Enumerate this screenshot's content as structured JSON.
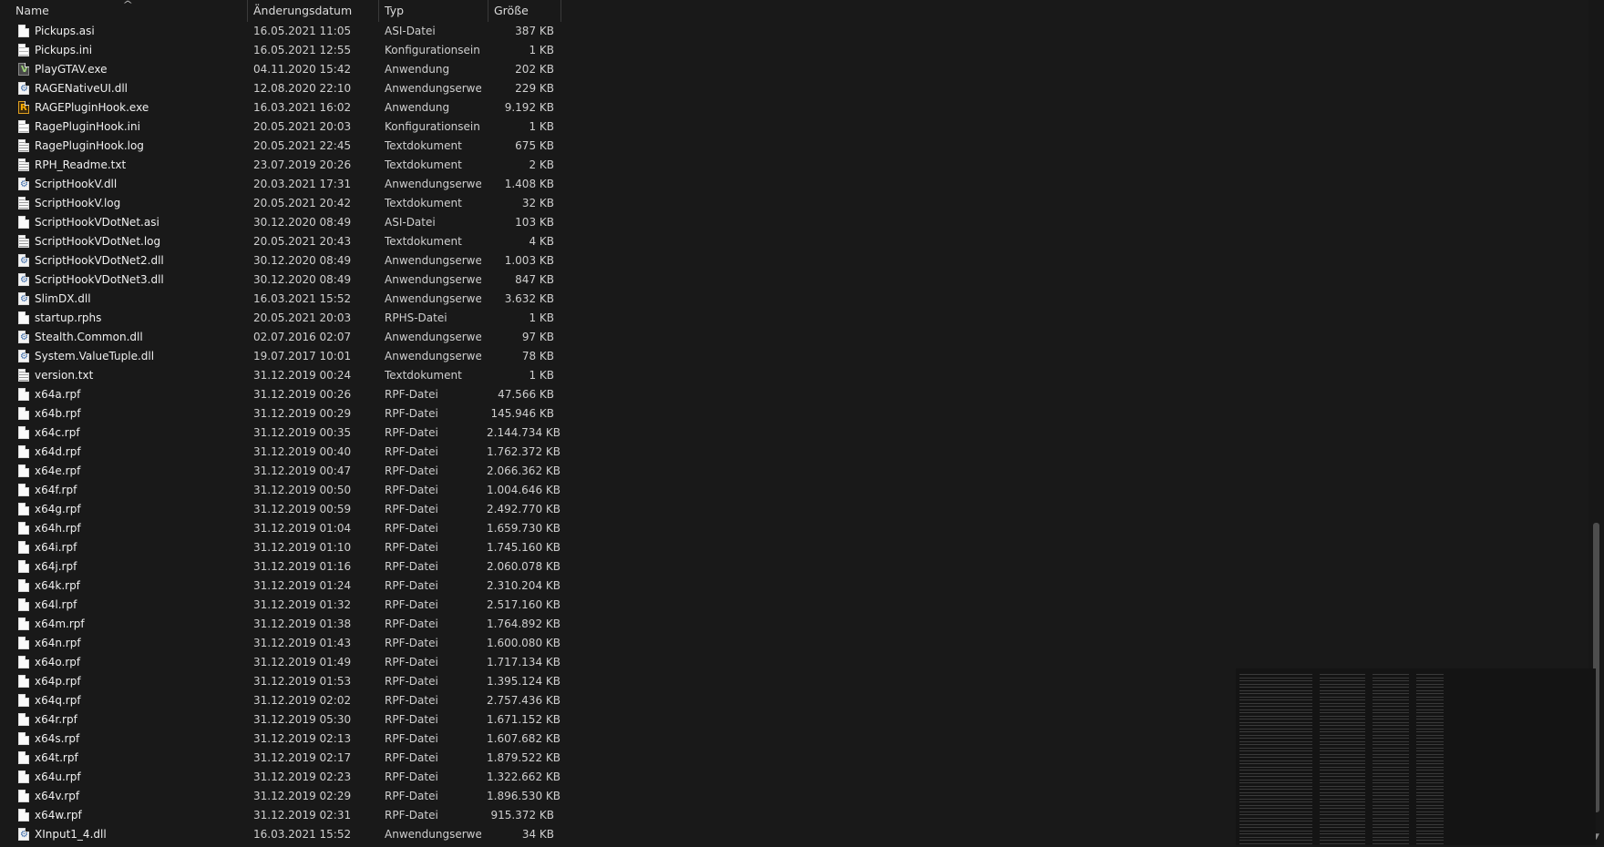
{
  "columns": {
    "name": "Name",
    "date": "Änderungsdatum",
    "type": "Typ",
    "size": "Größe"
  },
  "files": [
    {
      "name": "Pickups.asi",
      "date": "16.05.2021 11:05",
      "type": "ASI-Datei",
      "size": "387 KB",
      "icon": "file-icon"
    },
    {
      "name": "Pickups.ini",
      "date": "16.05.2021 12:55",
      "type": "Konfigurationsein...",
      "size": "1 KB",
      "icon": "config-file-icon"
    },
    {
      "name": "PlayGTAV.exe",
      "date": "04.11.2020 15:42",
      "type": "Anwendung",
      "size": "202 KB",
      "icon": "gtav-app-icon"
    },
    {
      "name": "RAGENativeUI.dll",
      "date": "12.08.2020 22:10",
      "type": "Anwendungserwe...",
      "size": "229 KB",
      "icon": "dll-icon"
    },
    {
      "name": "RAGEPluginHook.exe",
      "date": "16.03.2021 16:02",
      "type": "Anwendung",
      "size": "9.192 KB",
      "icon": "rph-app-icon"
    },
    {
      "name": "RagePluginHook.ini",
      "date": "20.05.2021 20:03",
      "type": "Konfigurationsein...",
      "size": "1 KB",
      "icon": "config-file-icon"
    },
    {
      "name": "RagePluginHook.log",
      "date": "20.05.2021 22:45",
      "type": "Textdokument",
      "size": "675 KB",
      "icon": "text-file-icon"
    },
    {
      "name": "RPH_Readme.txt",
      "date": "23.07.2019 20:26",
      "type": "Textdokument",
      "size": "2 KB",
      "icon": "text-file-icon"
    },
    {
      "name": "ScriptHookV.dll",
      "date": "20.03.2021 17:31",
      "type": "Anwendungserwe...",
      "size": "1.408 KB",
      "icon": "dll-icon"
    },
    {
      "name": "ScriptHookV.log",
      "date": "20.05.2021 20:42",
      "type": "Textdokument",
      "size": "32 KB",
      "icon": "text-file-icon"
    },
    {
      "name": "ScriptHookVDotNet.asi",
      "date": "30.12.2020 08:49",
      "type": "ASI-Datei",
      "size": "103 KB",
      "icon": "file-icon"
    },
    {
      "name": "ScriptHookVDotNet.log",
      "date": "20.05.2021 20:43",
      "type": "Textdokument",
      "size": "4 KB",
      "icon": "text-file-icon"
    },
    {
      "name": "ScriptHookVDotNet2.dll",
      "date": "30.12.2020 08:49",
      "type": "Anwendungserwe...",
      "size": "1.003 KB",
      "icon": "dll-icon"
    },
    {
      "name": "ScriptHookVDotNet3.dll",
      "date": "30.12.2020 08:49",
      "type": "Anwendungserwe...",
      "size": "847 KB",
      "icon": "dll-icon"
    },
    {
      "name": "SlimDX.dll",
      "date": "16.03.2021 15:52",
      "type": "Anwendungserwe...",
      "size": "3.632 KB",
      "icon": "dll-icon"
    },
    {
      "name": "startup.rphs",
      "date": "20.05.2021 20:03",
      "type": "RPHS-Datei",
      "size": "1 KB",
      "icon": "file-icon"
    },
    {
      "name": "Stealth.Common.dll",
      "date": "02.07.2016 02:07",
      "type": "Anwendungserwe...",
      "size": "97 KB",
      "icon": "dll-icon"
    },
    {
      "name": "System.ValueTuple.dll",
      "date": "19.07.2017 10:01",
      "type": "Anwendungserwe...",
      "size": "78 KB",
      "icon": "dll-icon"
    },
    {
      "name": "version.txt",
      "date": "31.12.2019 00:24",
      "type": "Textdokument",
      "size": "1 KB",
      "icon": "text-file-icon"
    },
    {
      "name": "x64a.rpf",
      "date": "31.12.2019 00:26",
      "type": "RPF-Datei",
      "size": "47.566 KB",
      "icon": "file-icon"
    },
    {
      "name": "x64b.rpf",
      "date": "31.12.2019 00:29",
      "type": "RPF-Datei",
      "size": "145.946 KB",
      "icon": "file-icon"
    },
    {
      "name": "x64c.rpf",
      "date": "31.12.2019 00:35",
      "type": "RPF-Datei",
      "size": "2.144.734 KB",
      "icon": "file-icon"
    },
    {
      "name": "x64d.rpf",
      "date": "31.12.2019 00:40",
      "type": "RPF-Datei",
      "size": "1.762.372 KB",
      "icon": "file-icon"
    },
    {
      "name": "x64e.rpf",
      "date": "31.12.2019 00:47",
      "type": "RPF-Datei",
      "size": "2.066.362 KB",
      "icon": "file-icon"
    },
    {
      "name": "x64f.rpf",
      "date": "31.12.2019 00:50",
      "type": "RPF-Datei",
      "size": "1.004.646 KB",
      "icon": "file-icon"
    },
    {
      "name": "x64g.rpf",
      "date": "31.12.2019 00:59",
      "type": "RPF-Datei",
      "size": "2.492.770 KB",
      "icon": "file-icon"
    },
    {
      "name": "x64h.rpf",
      "date": "31.12.2019 01:04",
      "type": "RPF-Datei",
      "size": "1.659.730 KB",
      "icon": "file-icon"
    },
    {
      "name": "x64i.rpf",
      "date": "31.12.2019 01:10",
      "type": "RPF-Datei",
      "size": "1.745.160 KB",
      "icon": "file-icon"
    },
    {
      "name": "x64j.rpf",
      "date": "31.12.2019 01:16",
      "type": "RPF-Datei",
      "size": "2.060.078 KB",
      "icon": "file-icon"
    },
    {
      "name": "x64k.rpf",
      "date": "31.12.2019 01:24",
      "type": "RPF-Datei",
      "size": "2.310.204 KB",
      "icon": "file-icon"
    },
    {
      "name": "x64l.rpf",
      "date": "31.12.2019 01:32",
      "type": "RPF-Datei",
      "size": "2.517.160 KB",
      "icon": "file-icon"
    },
    {
      "name": "x64m.rpf",
      "date": "31.12.2019 01:38",
      "type": "RPF-Datei",
      "size": "1.764.892 KB",
      "icon": "file-icon"
    },
    {
      "name": "x64n.rpf",
      "date": "31.12.2019 01:43",
      "type": "RPF-Datei",
      "size": "1.600.080 KB",
      "icon": "file-icon"
    },
    {
      "name": "x64o.rpf",
      "date": "31.12.2019 01:49",
      "type": "RPF-Datei",
      "size": "1.717.134 KB",
      "icon": "file-icon"
    },
    {
      "name": "x64p.rpf",
      "date": "31.12.2019 01:53",
      "type": "RPF-Datei",
      "size": "1.395.124 KB",
      "icon": "file-icon"
    },
    {
      "name": "x64q.rpf",
      "date": "31.12.2019 02:02",
      "type": "RPF-Datei",
      "size": "2.757.436 KB",
      "icon": "file-icon"
    },
    {
      "name": "x64r.rpf",
      "date": "31.12.2019 05:30",
      "type": "RPF-Datei",
      "size": "1.671.152 KB",
      "icon": "file-icon"
    },
    {
      "name": "x64s.rpf",
      "date": "31.12.2019 02:13",
      "type": "RPF-Datei",
      "size": "1.607.682 KB",
      "icon": "file-icon"
    },
    {
      "name": "x64t.rpf",
      "date": "31.12.2019 02:17",
      "type": "RPF-Datei",
      "size": "1.879.522 KB",
      "icon": "file-icon"
    },
    {
      "name": "x64u.rpf",
      "date": "31.12.2019 02:23",
      "type": "RPF-Datei",
      "size": "1.322.662 KB",
      "icon": "file-icon"
    },
    {
      "name": "x64v.rpf",
      "date": "31.12.2019 02:29",
      "type": "RPF-Datei",
      "size": "1.896.530 KB",
      "icon": "file-icon"
    },
    {
      "name": "x64w.rpf",
      "date": "31.12.2019 02:31",
      "type": "RPF-Datei",
      "size": "915.372 KB",
      "icon": "file-icon"
    },
    {
      "name": "XInput1_4.dll",
      "date": "16.03.2021 15:52",
      "type": "Anwendungserwe...",
      "size": "34 KB",
      "icon": "dll-icon"
    }
  ],
  "colors": {
    "background": "#191919",
    "text": "#f0f0f0",
    "secondary_text": "#cfcfcf",
    "scroll_thumb": "#4d4d4d"
  }
}
